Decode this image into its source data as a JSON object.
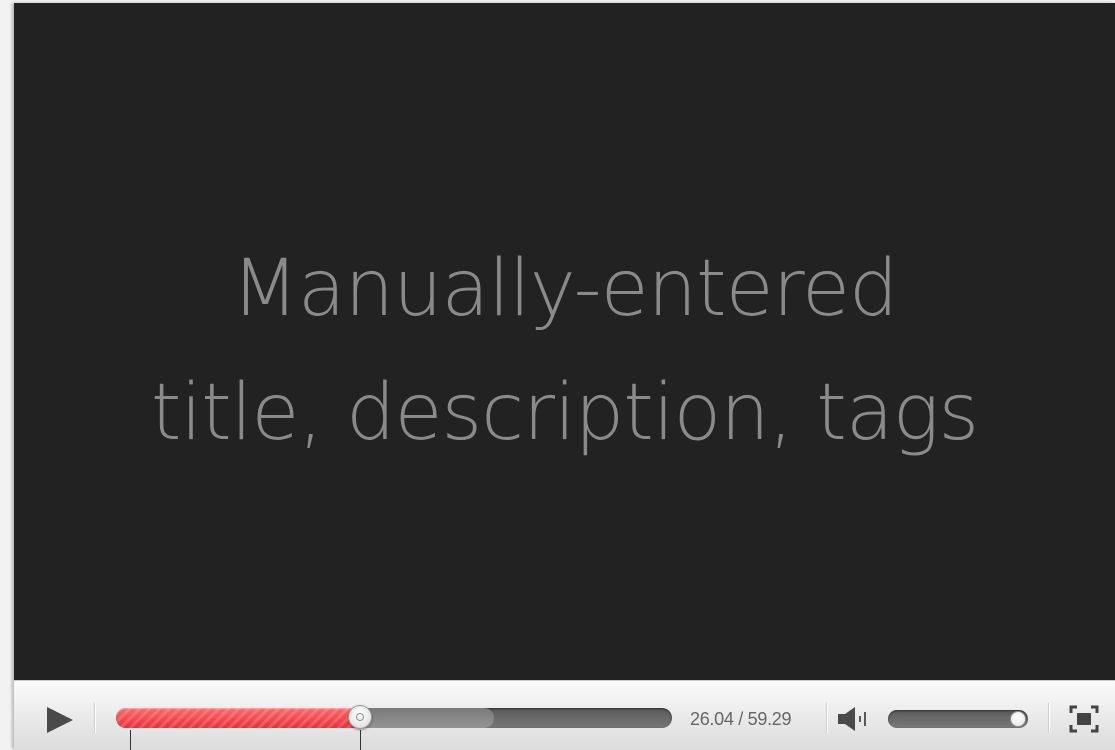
{
  "video": {
    "overlay_title": "Manually-entered\ntitle, description, tags",
    "background_color": "#222222",
    "text_color": "#8a8a8a"
  },
  "controls": {
    "play_icon": "play-icon",
    "current_time": "26.04",
    "total_time": "59.29",
    "time_separator": " / ",
    "time_display": "26.04 / 59.29",
    "played_fraction": 0.4392,
    "buffered_fraction": 0.68,
    "volume_icon": "speaker-icon",
    "volume_fraction": 0.93,
    "fullscreen_icon": "fullscreen-icon",
    "progress_color": "#e8303a"
  }
}
